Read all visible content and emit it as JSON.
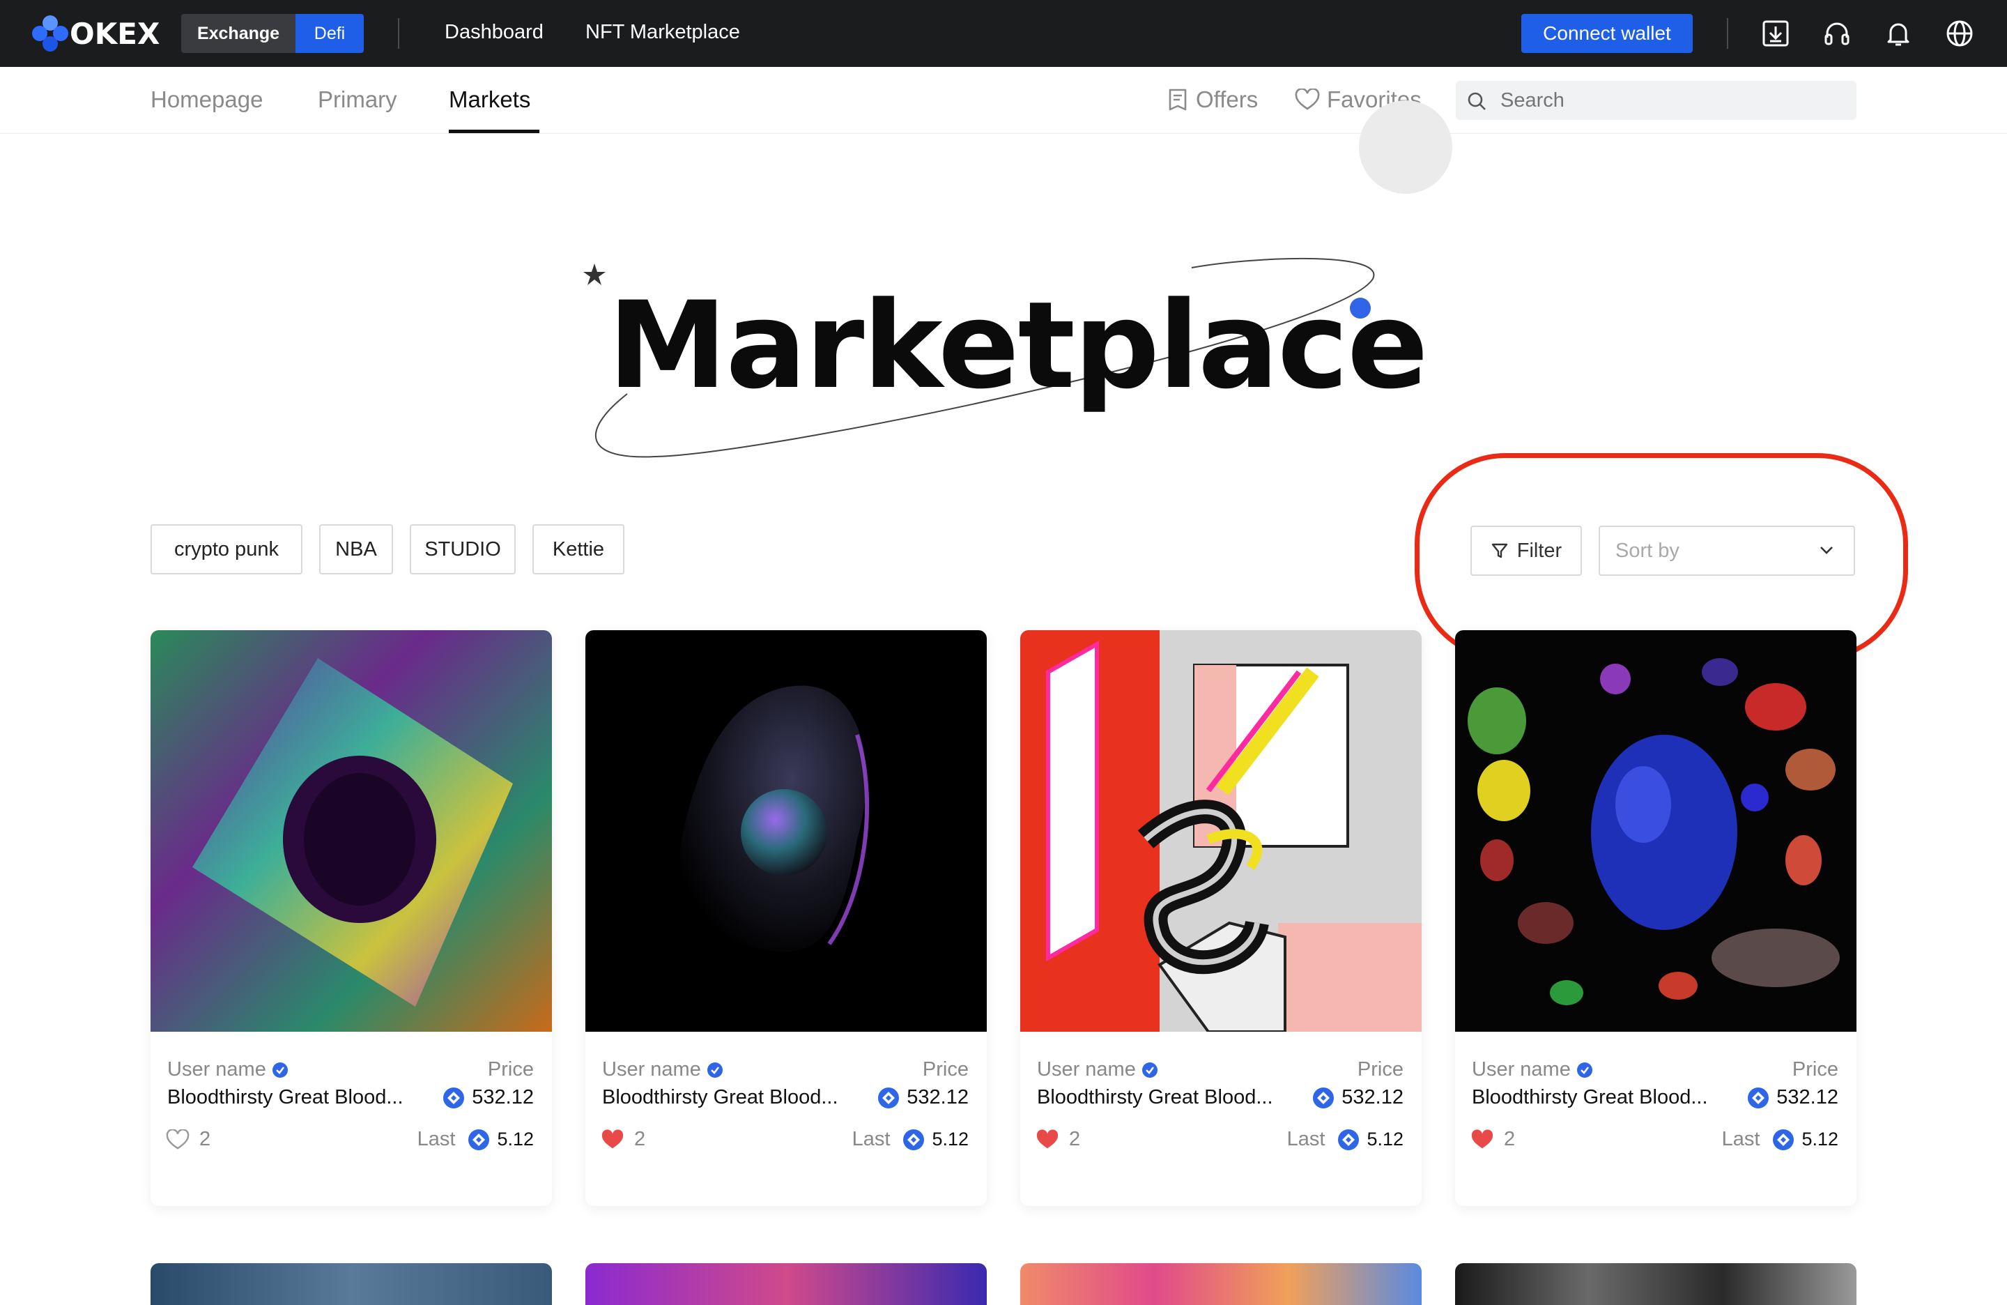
{
  "brand": {
    "name": "OKEX"
  },
  "topnav": {
    "segment": [
      "Exchange",
      "Defi"
    ],
    "links": [
      "Dashboard",
      "NFT Marketplace"
    ],
    "connect_label": "Connect wallet",
    "icons": [
      "download-icon",
      "headset-icon",
      "bell-icon",
      "globe-icon"
    ]
  },
  "subnav": {
    "tabs": [
      "Homepage",
      "Primary",
      "Markets"
    ],
    "active_tab": "Markets",
    "offers_label": "Offers",
    "favorites_label": "Favorites",
    "search_placeholder": "Search"
  },
  "hero": {
    "title": "Marketplace"
  },
  "filters": {
    "chips": [
      "crypto punk",
      "NBA",
      "STUDIO",
      "Kettie"
    ],
    "filter_label": "Filter",
    "sort_placeholder": "Sort by"
  },
  "cards": [
    {
      "user": "User name",
      "price_label": "Price",
      "name": "Bloodthirsty Great Blood...",
      "price": "532.12",
      "likes": "2",
      "liked": false,
      "last_label": "Last",
      "last": "5.12"
    },
    {
      "user": "User name",
      "price_label": "Price",
      "name": "Bloodthirsty Great Blood...",
      "price": "532.12",
      "likes": "2",
      "liked": true,
      "last_label": "Last",
      "last": "5.12"
    },
    {
      "user": "User name",
      "price_label": "Price",
      "name": "Bloodthirsty Great Blood...",
      "price": "532.12",
      "likes": "2",
      "liked": true,
      "last_label": "Last",
      "last": "5.12"
    },
    {
      "user": "User name",
      "price_label": "Price",
      "name": "Bloodthirsty Great Blood...",
      "price": "532.12",
      "likes": "2",
      "liked": true,
      "last_label": "Last",
      "last": "5.12"
    }
  ],
  "colors": {
    "accent": "#1f5fe8",
    "topbar": "#1b1c1e",
    "highlight": "#ea2a14",
    "heart": "#e84a4a"
  }
}
